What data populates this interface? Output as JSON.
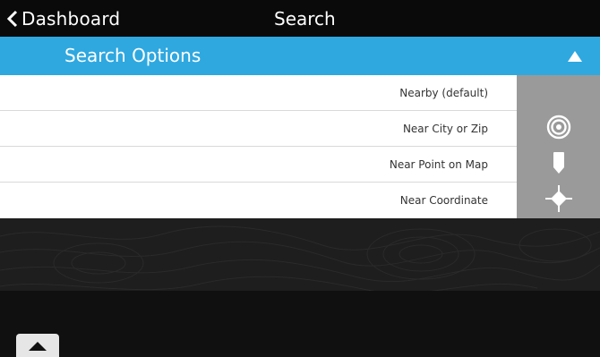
{
  "header": {
    "back_label": "Dashboard",
    "title": "Search"
  },
  "search_options": {
    "title": "Search Options",
    "toggle_icon": "triangle-up-icon",
    "accent_color": "#2fa8e0",
    "items": [
      {
        "label": "Nearby (default)",
        "icon": "none"
      },
      {
        "label": "Near City or Zip",
        "icon": "target-icon"
      },
      {
        "label": "Near Point on Map",
        "icon": "map-pin-icon"
      },
      {
        "label": "Near Coordinate",
        "icon": "crosshair-icon"
      }
    ]
  },
  "footer": {
    "expand_icon": "triangle-up-icon"
  }
}
